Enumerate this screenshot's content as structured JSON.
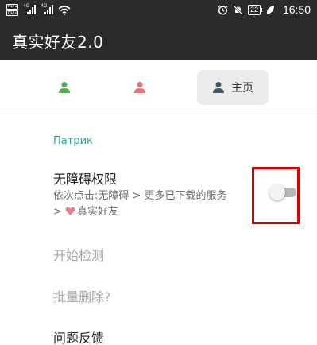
{
  "status_bar": {
    "hd_tags": [
      "HD 1",
      "HD 2"
    ],
    "network_1": "4G",
    "network_2": "4G",
    "battery": "22",
    "time": "16:50"
  },
  "app_bar": {
    "title": "真实好友2.0"
  },
  "tabs": [
    {
      "icon": "person-icon",
      "color": "#4caf50",
      "label": ""
    },
    {
      "icon": "person-icon",
      "color": "#e57373",
      "label": ""
    },
    {
      "icon": "person-icon",
      "color": "#455a64",
      "label": "主页",
      "selected": true
    }
  ],
  "section": {
    "header": "Патрик"
  },
  "prefs": {
    "accessibility": {
      "title": "无障碍权限",
      "summary_line1": "依次点击:无障碍 > 更多已下载的服务",
      "summary_line2_prefix": ">",
      "summary_line2_suffix": "真实好友",
      "enabled": false
    },
    "start_detect": {
      "title": "开始检测",
      "enabled": false
    },
    "batch_delete": {
      "title": "批量删除?",
      "enabled": false
    },
    "feedback": {
      "title": "问题反馈"
    }
  },
  "colors": {
    "accent": "#26a69a",
    "highlight": "#d50000",
    "app_bar": "#2b2b2b"
  }
}
